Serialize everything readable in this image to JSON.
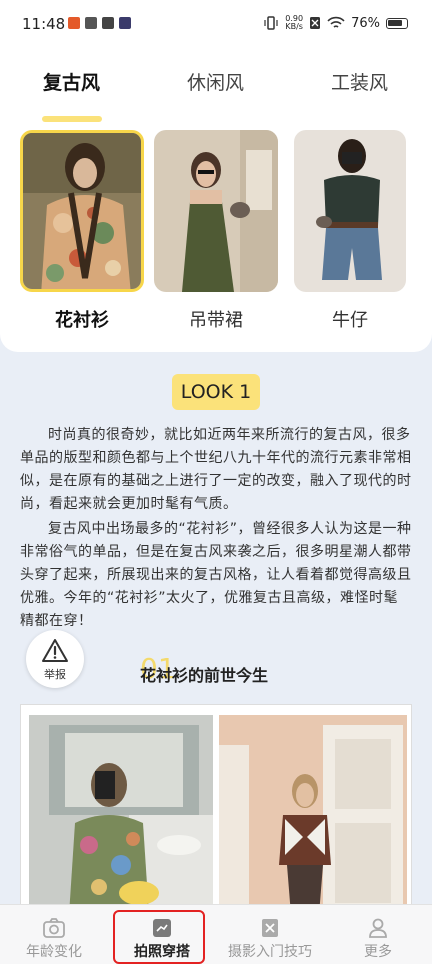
{
  "status": {
    "time": "11:48",
    "net_speed_value": "0.90",
    "net_speed_unit": "KB/s",
    "battery": "76%"
  },
  "tabs": [
    "复古风",
    "休闲风",
    "工装风"
  ],
  "styles": [
    {
      "label": "花衬衫",
      "selected": true
    },
    {
      "label": "吊带裙",
      "selected": false
    },
    {
      "label": "牛仔",
      "selected": false
    }
  ],
  "look": "LOOK 1",
  "paragraphs": [
    "时尚真的很奇妙，就比如近两年来所流行的复古风，很多单品的版型和颜色都与上个世纪八九十年代的流行元素非常相似，是在原有的基础之上进行了一定的改变，融入了现代的时尚，看起来就会更加时髦有气质。",
    "复古风中出场最多的“花衬衫”，曾经很多人认为这是一种非常俗气的单品，但是在复古风来袭之后，很多明星潮人都带头穿了起来，所展现出来的复古风格，让人看着都觉得高级且优雅。今年的“花衬衫”太火了，优雅复古且高级，难怪时髦精都在穿！"
  ],
  "report_label": "举报",
  "section": {
    "num": "01",
    "title": "花衬衫的前世今生"
  },
  "bottom_nav": [
    {
      "label": "年龄变化",
      "icon": "camera-icon",
      "active": false
    },
    {
      "label": "拍照穿搭",
      "icon": "photo-outfit-icon",
      "active": true
    },
    {
      "label": "摄影入门技巧",
      "icon": "book-icon",
      "active": false
    },
    {
      "label": "更多",
      "icon": "person-icon",
      "active": false
    }
  ],
  "colors": {
    "accent": "#f7d64a",
    "highlight": "#e32222",
    "background": "#e9eef6"
  }
}
